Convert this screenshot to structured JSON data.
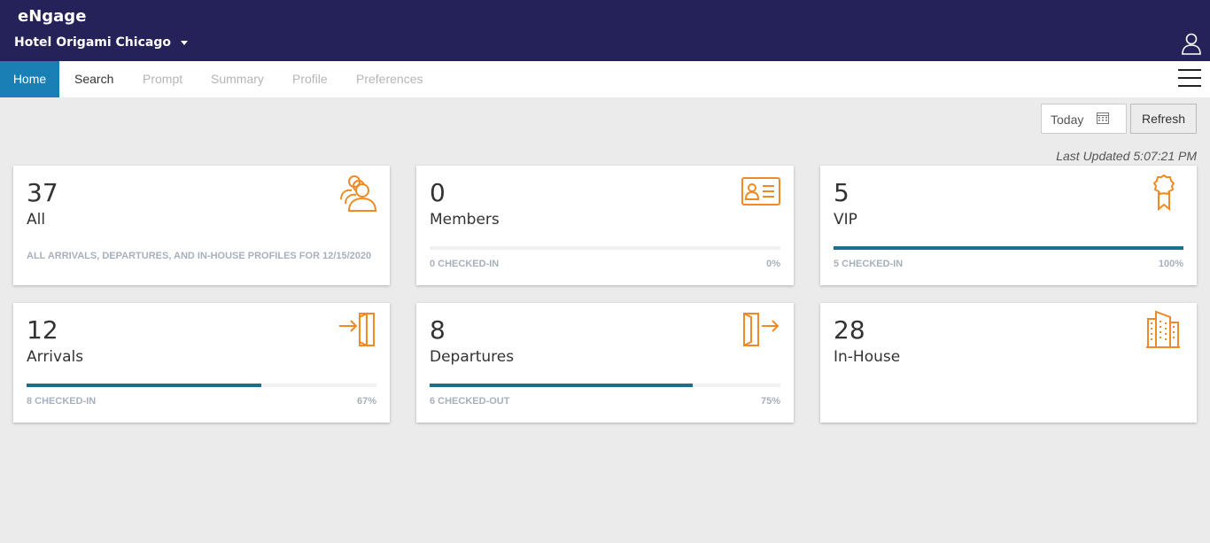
{
  "header": {
    "app_title": "eNgage",
    "hotel_name": "Hotel Origami Chicago",
    "user_icon": "user-icon"
  },
  "nav": {
    "tabs": [
      {
        "label": "Home",
        "state": "active"
      },
      {
        "label": "Search",
        "state": "enabled"
      },
      {
        "label": "Prompt",
        "state": "disabled"
      },
      {
        "label": "Summary",
        "state": "disabled"
      },
      {
        "label": "Profile",
        "state": "disabled"
      },
      {
        "label": "Preferences",
        "state": "disabled"
      }
    ],
    "menu_icon": "hamburger-menu-icon"
  },
  "toolbar": {
    "date_label": "Today",
    "calendar_icon": "calendar-icon",
    "refresh_label": "Refresh",
    "last_updated": "Last Updated 5:07:21 PM"
  },
  "colors": {
    "header_bg": "#242258",
    "active_tab": "#1a7fb5",
    "icon_accent": "#f08a24",
    "progress": "#1a6f8f",
    "background": "#ebebeb"
  },
  "cards": {
    "all": {
      "count": "37",
      "title": "All",
      "description": "ALL ARRIVALS, DEPARTURES, AND IN-HOUSE PROFILES FOR 12/15/2020",
      "icon": "guests-icon"
    },
    "members": {
      "count": "0",
      "title": "Members",
      "status": "0 CHECKED-IN",
      "percent_label": "0%",
      "progress": 0,
      "icon": "member-card-icon"
    },
    "vip": {
      "count": "5",
      "title": "VIP",
      "status": "5 CHECKED-IN",
      "percent_label": "100%",
      "progress": 100,
      "icon": "award-ribbon-icon"
    },
    "arrivals": {
      "count": "12",
      "title": "Arrivals",
      "status": "8 CHECKED-IN",
      "percent_label": "67%",
      "progress": 67,
      "icon": "door-enter-icon"
    },
    "departures": {
      "count": "8",
      "title": "Departures",
      "status": "6 CHECKED-OUT",
      "percent_label": "75%",
      "progress": 75,
      "icon": "door-exit-icon"
    },
    "inhouse": {
      "count": "28",
      "title": "In-House",
      "icon": "hotel-building-icon"
    }
  }
}
